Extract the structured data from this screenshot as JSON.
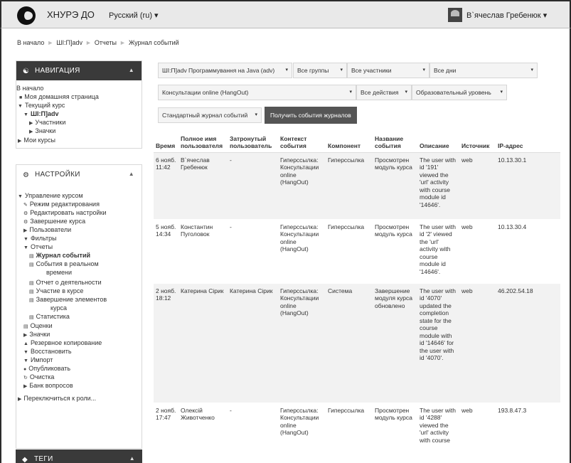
{
  "header": {
    "brand": "ХНУРЭ ДО",
    "language": "Русский (ru)",
    "language_caret": "▾",
    "user": "В`ячеслав Гребенюк",
    "user_caret": "▾"
  },
  "breadcrumb": {
    "items": [
      "В начало",
      "ШІ:П]adv",
      "Отчеты",
      "Журнал событий"
    ],
    "separator": "►"
  },
  "navigation": {
    "title": "НАВИГАЦИЯ",
    "items": [
      {
        "label": "В начало",
        "bold": false
      },
      {
        "label": "Моя домашняя страница",
        "bold": false
      },
      {
        "label": "Текущий курс",
        "bold": false
      },
      {
        "label": "ШІ:П]adv",
        "bold": true
      },
      {
        "label": "Участники",
        "bold": false
      },
      {
        "label": "Значки",
        "bold": false
      },
      {
        "label": "Мои курсы",
        "bold": false
      }
    ]
  },
  "settings": {
    "title": "НАСТРОЙКИ",
    "items": [
      {
        "label": "Управление курсом",
        "icon": "caret-down"
      },
      {
        "label": "Режим редактирования",
        "icon": "pencil"
      },
      {
        "label": "Редактировать настройки",
        "icon": "gear"
      },
      {
        "label": "Завершение курса",
        "icon": "gear"
      },
      {
        "label": "Пользователи",
        "icon": "caret-right"
      },
      {
        "label": "Фильтры",
        "icon": "filter"
      },
      {
        "label": "Отчеты",
        "icon": "caret-down"
      },
      {
        "label": "Журнал событий",
        "icon": "report",
        "bold": true
      },
      {
        "label": "События в реальном",
        "icon": "report"
      },
      {
        "label": "времени",
        "icon": ""
      },
      {
        "label": "Отчет о деятельности",
        "icon": "report"
      },
      {
        "label": "Участие в курсе",
        "icon": "report"
      },
      {
        "label": "Завершение элементов",
        "icon": "report"
      },
      {
        "label": "курса",
        "icon": ""
      },
      {
        "label": "Статистика",
        "icon": "report"
      },
      {
        "label": "Оценки",
        "icon": "grades"
      },
      {
        "label": "Значки",
        "icon": "caret-right"
      },
      {
        "label": "Резервное копирование",
        "icon": "backup"
      },
      {
        "label": "Восстановить",
        "icon": "restore"
      },
      {
        "label": "Импорт",
        "icon": "import"
      },
      {
        "label": "Опубликовать",
        "icon": "publish"
      },
      {
        "label": "Очистка",
        "icon": "reset"
      },
      {
        "label": "Банк вопросов",
        "icon": "caret-right"
      }
    ],
    "switch_role": "Переключиться к роли..."
  },
  "tags": {
    "title": "ТЕГИ"
  },
  "filters": {
    "course": "ШІ:П]adv Программування на Java (adv)",
    "groups": "Все группы",
    "participants": "Все участники",
    "days": "Все дни",
    "activity": "Консультации online (HangOut)",
    "actions": "Все действия",
    "level": "Образовательный уровень",
    "log_type": "Стандартный журнал событий",
    "submit": "Получить события журналов",
    "caret": "▾"
  },
  "table": {
    "headers": [
      "Время",
      "Полное имя пользователя",
      "Затронутый пользователь",
      "Контекст события",
      "Компонент",
      "Название события",
      "Описание",
      "Источник",
      "IP-адрес"
    ],
    "rows": [
      {
        "time": "6 нояб. 11:42",
        "name": "В`ячеслав Гребенюк",
        "affected": "-",
        "context": "Гиперссылка: Консультации online (HangOut)",
        "component": "Гиперссылка",
        "event": "Просмотрен модуль курса",
        "desc": "The user with id '191' viewed the 'url' activity with course module id '14646'.",
        "origin": "web",
        "ip": "10.13.30.1"
      },
      {
        "time": "5 нояб. 14:34",
        "name": "Константин Пуголовок",
        "affected": "-",
        "context": "Гиперссылка: Консультации online (HangOut)",
        "component": "Гиперссылка",
        "event": "Просмотрен модуль курса",
        "desc": "The user with id '2' viewed the 'url' activity with course module id '14646'.",
        "origin": "web",
        "ip": "10.13.30.4"
      },
      {
        "time": "2 нояб. 18:12",
        "name": "Катерина Сірик",
        "affected": "Катерина Сірик",
        "context": "Гиперссылка: Консультации online (HangOut)",
        "component": "Система",
        "event": "Завершение модуля курса обновлено",
        "desc": "The user with id '4070' updated the completion state for the course module with id '14646' for the user with id '4070'.",
        "origin": "web",
        "ip": "46.202.54.18"
      },
      {
        "time": "2 нояб. 17:47",
        "name": "Олексій Животченко",
        "affected": "-",
        "context": "Гиперссылка: Консультации online (HangOut)",
        "component": "Гиперссылка",
        "event": "Просмотрен модуль курса",
        "desc": "The user with id '4288' viewed the 'url' activity with course",
        "origin": "web",
        "ip": "193.8.47.3"
      }
    ]
  }
}
